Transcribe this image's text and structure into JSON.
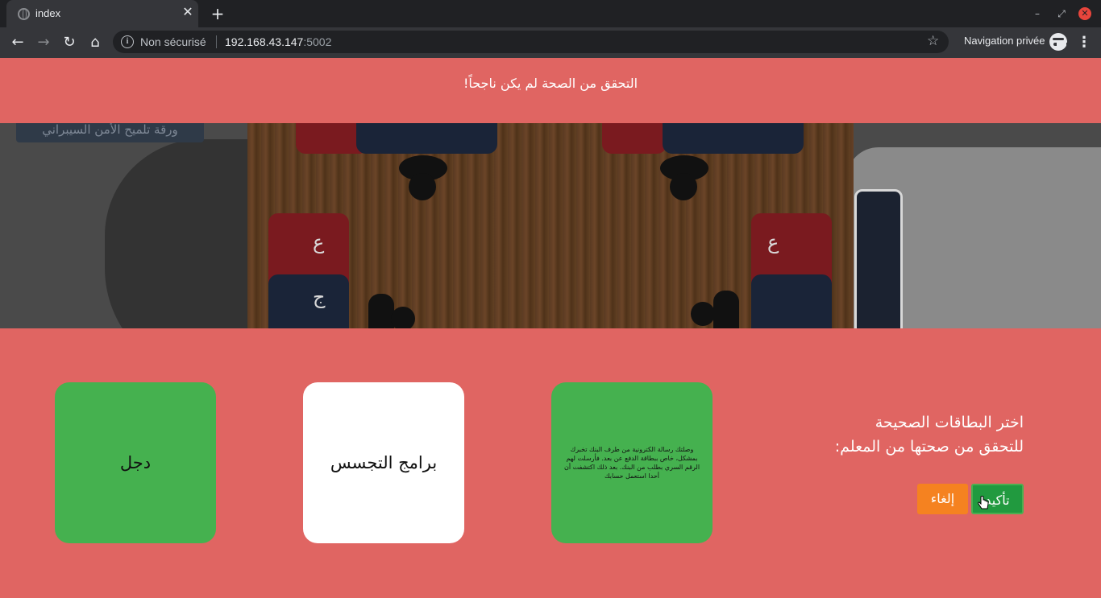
{
  "browser": {
    "tab_title": "index",
    "tab_close": "✕",
    "new_tab": "+",
    "security_label": "Non sécurisé",
    "url_host": "192.168.43.147",
    "url_port": ":5002",
    "private_label": "Navigation privée"
  },
  "alert": {
    "message": "التحقق من الصحة لم يكن ناجحاً!"
  },
  "hero": {
    "banner_button": "ورقة تلميح الأمن السيبراني"
  },
  "quiz": {
    "question_line1": "اختر البطاقات الصحيحة",
    "question_line2": "للتحقق من صحتها من المعلم:",
    "confirm_label": "تأكيد",
    "cancel_label": "إلغاء",
    "cards": [
      {
        "text": "وصلتك رسالة الكترونية من طرف البنك تخبرك بمشكل، خاص ببطاقة الدفع عن بعد. فأرسلت لهم الرقم السري بطلب من البنك. بعد ذلك اكتشفت أن أحدا استعمل حسابك",
        "state": "selected"
      },
      {
        "text": "برامج التجسس",
        "state": "unselected"
      },
      {
        "text": "دجل",
        "state": "selected"
      }
    ]
  },
  "colors": {
    "page_bg": "#e06562",
    "selected_card": "#45b14f",
    "confirm_button": "#219a3f",
    "cancel_button": "#f58220"
  }
}
